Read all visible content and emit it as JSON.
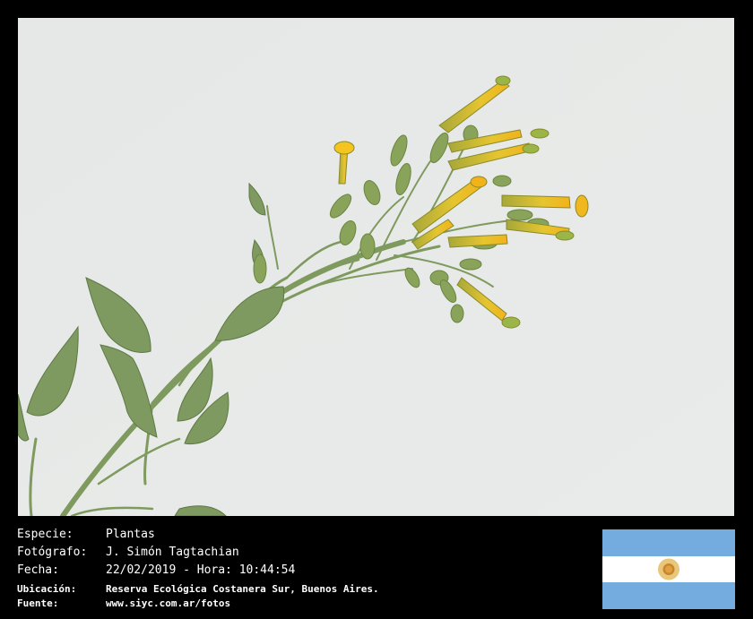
{
  "photo": {
    "subject": "plant-branch-with-yellow-tubular-flowers"
  },
  "info": {
    "especie": {
      "label": "Especie:",
      "value": "Plantas"
    },
    "fotografo": {
      "label": "Fotógrafo:",
      "value": "J. Simón Tagtachian"
    },
    "fecha": {
      "label": "Fecha:",
      "value": "22/02/2019 - Hora: 10:44:54"
    },
    "ubicacion": {
      "label": "Ubicación:",
      "value": "Reserva Ecológica Costanera Sur, Buenos Aires."
    },
    "fuente": {
      "label": "Fuente:",
      "value": "www.siyc.com.ar/fotos"
    }
  },
  "flag": {
    "country": "argentina-flag",
    "colors": {
      "sky_blue": "#74ACDF",
      "white": "#FFFFFF",
      "sun": "#D9A441"
    }
  }
}
